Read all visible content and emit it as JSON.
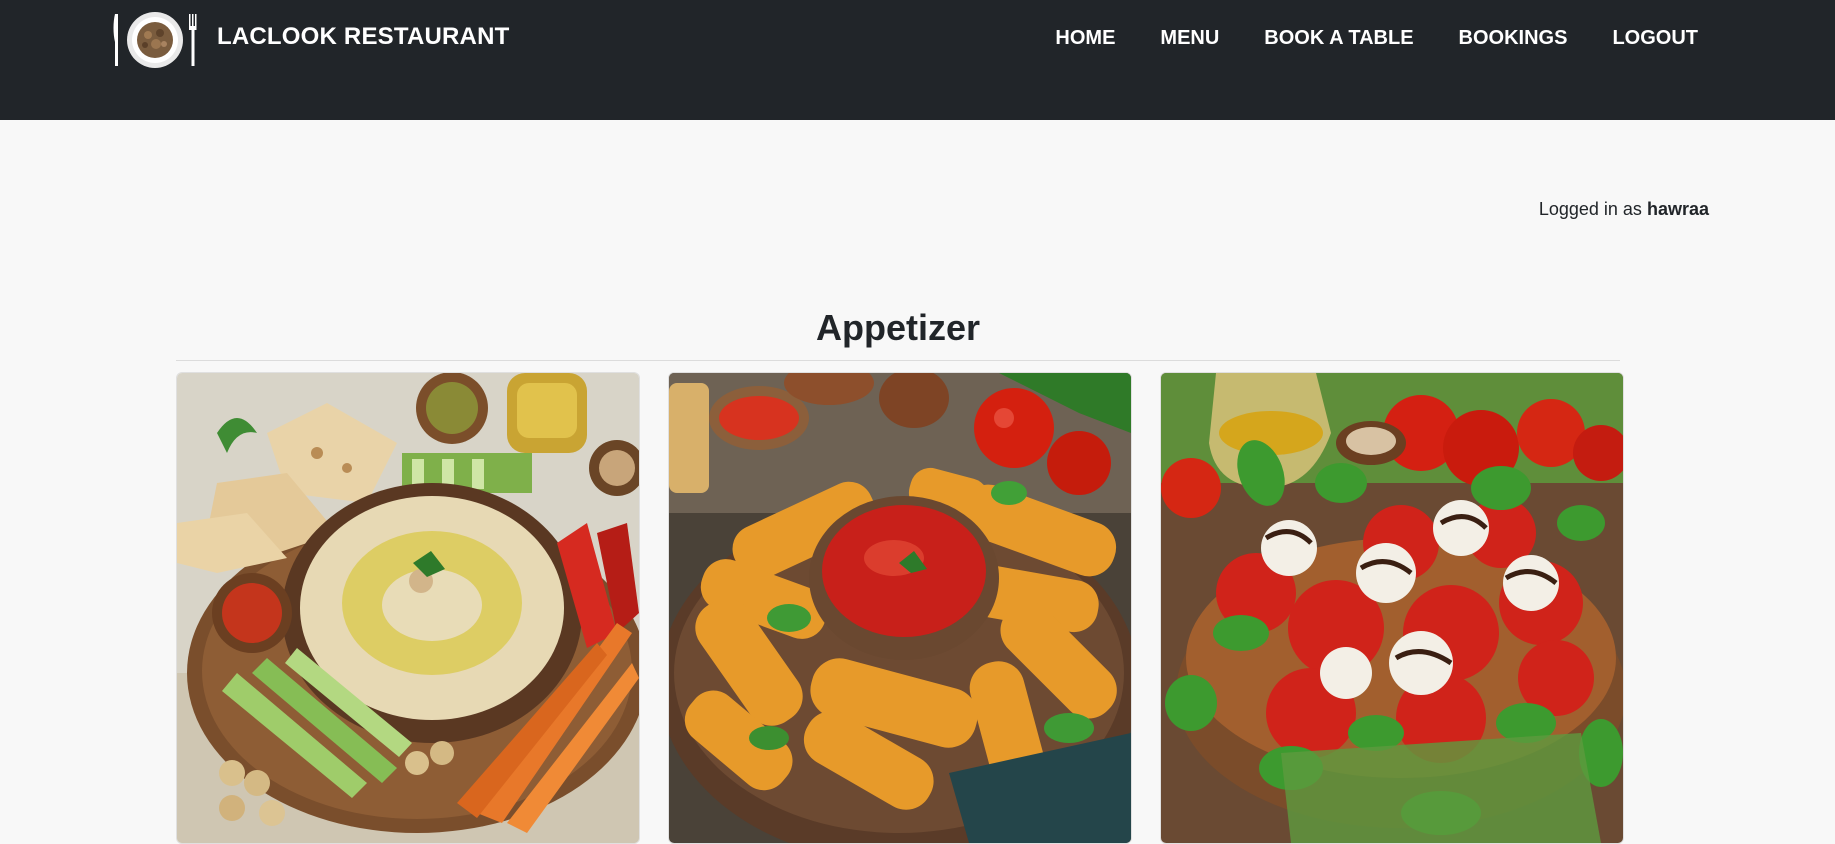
{
  "brand": {
    "name": "LACLOOK RESTAURANT",
    "logo_icon": "plate-fork-knife-icon"
  },
  "nav": {
    "items": [
      {
        "label": "HOME"
      },
      {
        "label": "MENU"
      },
      {
        "label": "BOOK A TABLE"
      },
      {
        "label": "BOOKINGS"
      },
      {
        "label": "LOGOUT"
      }
    ]
  },
  "session": {
    "prefix": "Logged in as",
    "username": "hawraa"
  },
  "section": {
    "title": "Appetizer"
  },
  "menu_items": [
    {
      "image": "hummus-platter-photo"
    },
    {
      "image": "mozzarella-sticks-photo"
    },
    {
      "image": "caprese-salad-photo"
    }
  ],
  "colors": {
    "navbar": "#212529",
    "page_background": "#f8f8f8",
    "nav_text": "#ffffff"
  }
}
